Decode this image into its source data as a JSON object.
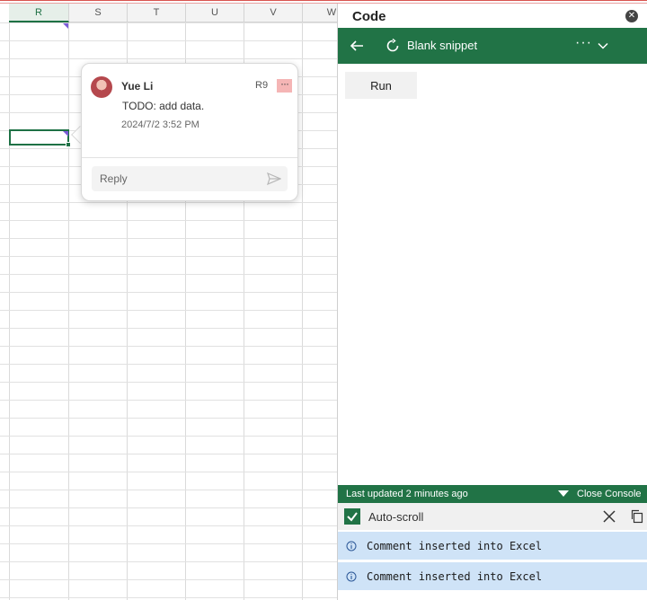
{
  "spreadsheet": {
    "columns": [
      "R",
      "S",
      "T",
      "U",
      "V",
      "W"
    ],
    "active_column": "R"
  },
  "comment": {
    "author": "Yue Li",
    "cell_ref": "R9",
    "more_label": "···",
    "text": "TODO: add data.",
    "timestamp": "2024/7/2 3:52 PM",
    "reply_placeholder": "Reply"
  },
  "pane": {
    "title": "Code",
    "snippet_title": "Blank snippet",
    "more_label": "···",
    "run_label": "Run",
    "status_left": "Last updated 2 minutes ago",
    "close_console_label": "Close Console",
    "autoscroll_label": "Auto-scroll",
    "log_entries": [
      "Comment inserted into Excel",
      "Comment inserted into Excel"
    ]
  },
  "colors": {
    "excel_green": "#217346",
    "log_bg": "#cfe3f7",
    "more_bg": "#f5b5b5"
  }
}
